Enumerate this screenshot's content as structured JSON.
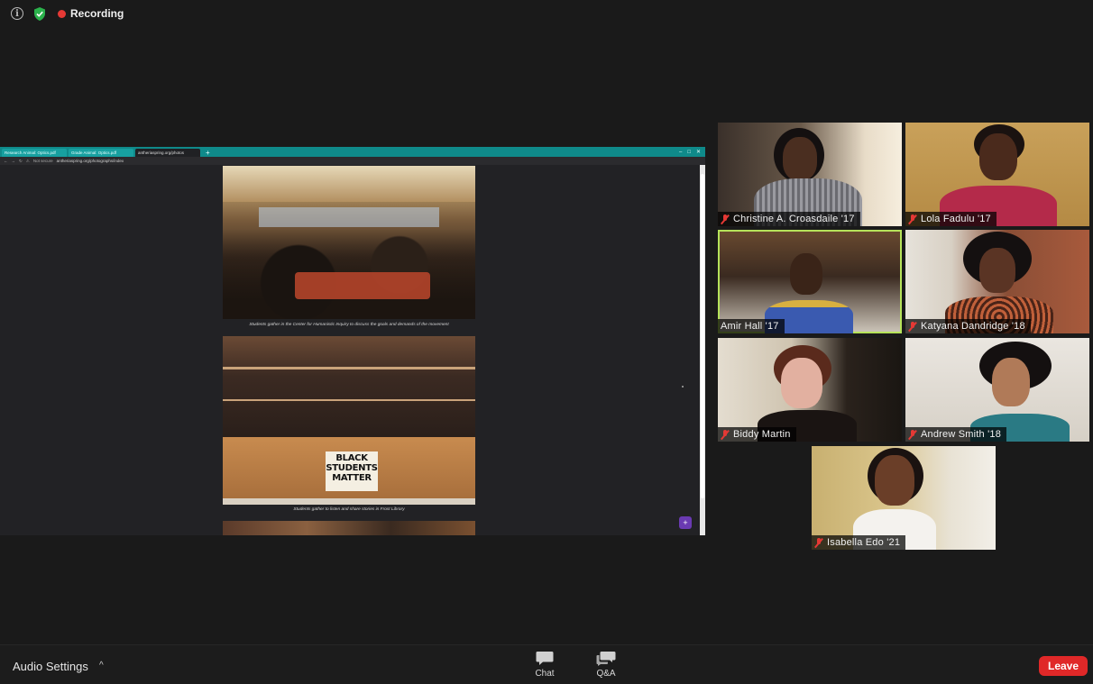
{
  "status": {
    "recording_label": "Recording"
  },
  "browser": {
    "tabs": [
      {
        "label": "Research Animal: Optics.pdf"
      },
      {
        "label": "Grade Animal: Optics.pdf"
      },
      {
        "label": "antheriaspring.org/photos"
      }
    ],
    "url_security": "Not secure",
    "url": "antheriaspring.org/photographs/index"
  },
  "shared_page": {
    "captions": [
      "Students gather in the Center for Humanistic Inquiry to discuss the goals and demands of the movement",
      "Students gather to listen and share stories in Frost Library"
    ],
    "sign_text": "BLACK STUDENTS MATTER"
  },
  "participants": [
    {
      "name": "Christine A. Croasdaile '17",
      "muted": true,
      "active": false
    },
    {
      "name": "Lola Fadulu '17",
      "muted": true,
      "active": false
    },
    {
      "name": "Amir Hall '17",
      "muted": false,
      "active": true
    },
    {
      "name": "Katyana Dandridge '18",
      "muted": true,
      "active": false
    },
    {
      "name": "Biddy Martin",
      "muted": true,
      "active": false
    },
    {
      "name": "Andrew Smith '18",
      "muted": true,
      "active": false
    },
    {
      "name": "Isabella Edo '21",
      "muted": true,
      "active": false
    }
  ],
  "toolbar": {
    "audio_settings_label": "Audio Settings",
    "chat_label": "Chat",
    "qa_label": "Q&A",
    "leave_label": "Leave"
  },
  "colors": {
    "recording": "#e53935",
    "shield": "#2bb24c",
    "active_speaker": "#b6e35a",
    "leave": "#e02828",
    "browser_tabstrip": "#0f8a8a"
  }
}
